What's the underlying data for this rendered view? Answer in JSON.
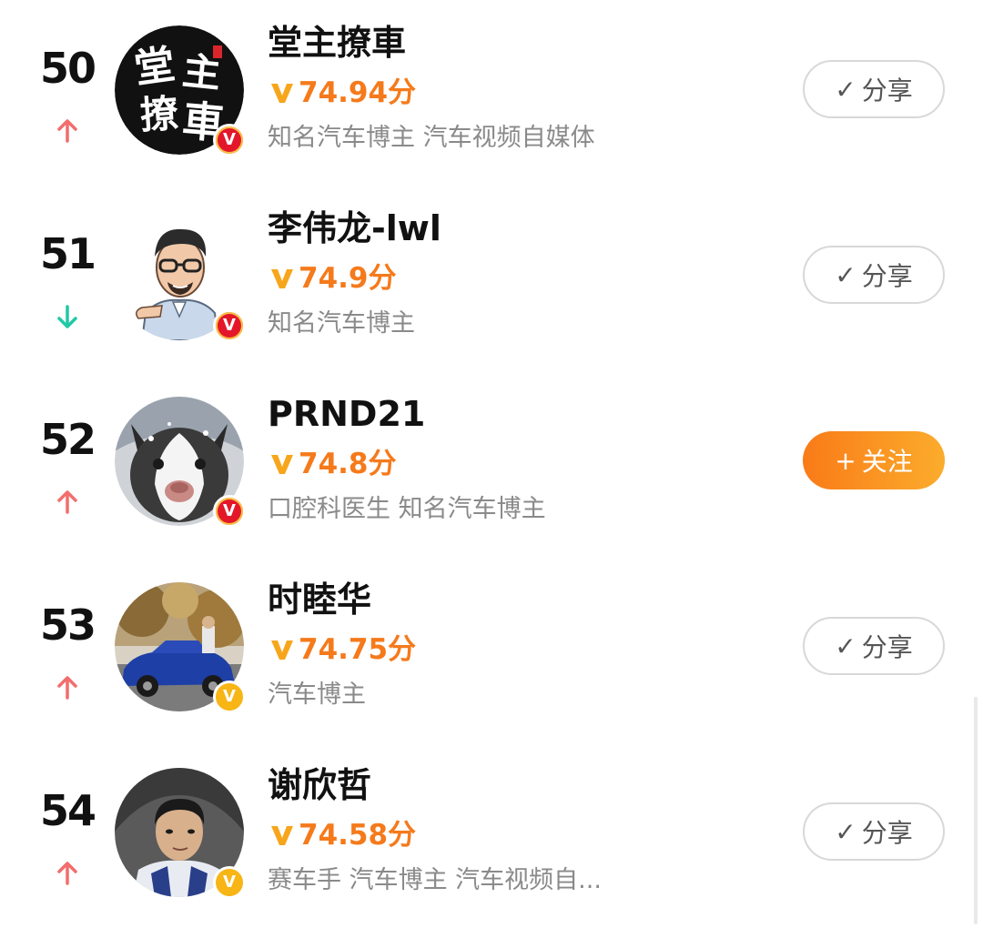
{
  "items": [
    {
      "rank": "50",
      "trend": "up",
      "name": "堂主撩車",
      "score": "74.94分",
      "description": "知名汽车博主 汽车视频自媒体",
      "verified_badge": "V",
      "badge_color": "red",
      "button": {
        "icon": "✓",
        "label": "分享",
        "type": "share"
      }
    },
    {
      "rank": "51",
      "trend": "down",
      "name": "李伟龙-lwl",
      "score": "74.9分",
      "description": "知名汽车博主",
      "verified_badge": "V",
      "badge_color": "red",
      "button": {
        "icon": "✓",
        "label": "分享",
        "type": "share"
      }
    },
    {
      "rank": "52",
      "trend": "up",
      "name": "PRND21",
      "score": "74.8分",
      "description": "口腔科医生 知名汽车博主",
      "verified_badge": "V",
      "badge_color": "red",
      "button": {
        "icon": "+",
        "label": "关注",
        "type": "follow"
      }
    },
    {
      "rank": "53",
      "trend": "up",
      "name": "时睦华",
      "score": "74.75分",
      "description": "汽车博主",
      "verified_badge": "V",
      "badge_color": "yellow",
      "button": {
        "icon": "✓",
        "label": "分享",
        "type": "share"
      }
    },
    {
      "rank": "54",
      "trend": "up",
      "name": "谢欣哲",
      "score": "74.58分",
      "description": "赛车手 汽车博主 汽车视频自...",
      "verified_badge": "V",
      "badge_color": "yellow",
      "button": {
        "icon": "✓",
        "label": "分享",
        "type": "share"
      }
    }
  ],
  "avatar_1_text": [
    "堂",
    "主",
    "撩",
    "車"
  ],
  "colors": {
    "score": "#f57a1b",
    "trend_up": "#f26d6d",
    "trend_down": "#20c9a6",
    "follow_button": "#f98a1f"
  }
}
